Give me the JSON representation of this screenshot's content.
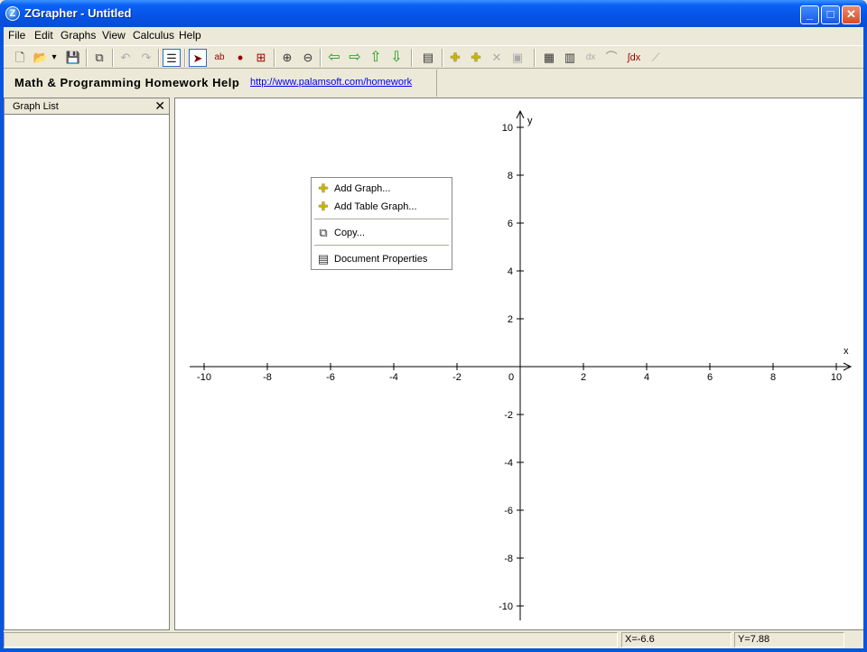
{
  "window": {
    "title": "ZGrapher - Untitled",
    "app_icon_letter": "Z",
    "minimize": "_",
    "maximize": "□",
    "close": "✕"
  },
  "menu": {
    "items": [
      "File",
      "Edit",
      "Graphs",
      "View",
      "Calculus",
      "Help"
    ]
  },
  "toolbar": {
    "buttons": [
      {
        "name": "new-icon",
        "glyph": "🗋"
      },
      {
        "name": "open-icon",
        "glyph": "📂"
      },
      {
        "name": "open-dropdown-icon",
        "glyph": "▾"
      },
      {
        "name": "save-icon",
        "glyph": "💾"
      },
      {
        "name": "copy-icon",
        "glyph": "⧉"
      },
      {
        "name": "undo-icon",
        "glyph": "↶"
      },
      {
        "name": "redo-icon",
        "glyph": "↷"
      },
      {
        "name": "graph-list-icon",
        "glyph": "☰"
      },
      {
        "name": "pointer-icon",
        "glyph": "➤"
      },
      {
        "name": "add-label-icon",
        "glyph": "ab"
      },
      {
        "name": "add-point-icon",
        "glyph": "•"
      },
      {
        "name": "zoom-box-icon",
        "glyph": "⊞"
      },
      {
        "name": "zoom-in-icon",
        "glyph": "⊕"
      },
      {
        "name": "zoom-out-icon",
        "glyph": "⊖"
      },
      {
        "name": "pan-left-icon",
        "glyph": "⇦"
      },
      {
        "name": "pan-right-icon",
        "glyph": "⇨"
      },
      {
        "name": "pan-up-icon",
        "glyph": "⇧"
      },
      {
        "name": "pan-down-icon",
        "glyph": "⇩"
      },
      {
        "name": "document-properties-icon",
        "glyph": "▤"
      },
      {
        "name": "add-graph-icon",
        "glyph": "✚"
      },
      {
        "name": "add-table-graph-icon",
        "glyph": "✚"
      },
      {
        "name": "delete-graph-icon",
        "glyph": "✕"
      },
      {
        "name": "graph-properties-icon",
        "glyph": "▣"
      },
      {
        "name": "table-icon",
        "glyph": "▦"
      },
      {
        "name": "calculator-icon",
        "glyph": "▥"
      },
      {
        "name": "derivative-icon",
        "glyph": "dx"
      },
      {
        "name": "tangent-icon",
        "glyph": "⌒"
      },
      {
        "name": "integral-icon",
        "glyph": "∫dx"
      },
      {
        "name": "regression-icon",
        "glyph": "⟋"
      }
    ]
  },
  "banner": {
    "title": "Math & Programming Homework Help",
    "link": "http://www.palamsoft.com/homework"
  },
  "graph_list": {
    "title": "Graph List",
    "close": "✕"
  },
  "context_menu": {
    "items": [
      {
        "label": "Add Graph...",
        "icon": "✚"
      },
      {
        "label": "Add Table Graph...",
        "icon": "✚"
      },
      {
        "label": "Copy...",
        "icon": "⧉"
      },
      {
        "label": "Document Properties",
        "icon": "▤"
      }
    ]
  },
  "chart_data": {
    "type": "line",
    "xlabel": "x",
    "ylabel": "y",
    "xlim": [
      -10,
      10
    ],
    "ylim": [
      -10,
      10
    ],
    "x_ticks": [
      -10,
      -8,
      -6,
      -4,
      -2,
      0,
      2,
      4,
      6,
      8,
      10
    ],
    "y_ticks": [
      10,
      8,
      6,
      4,
      2,
      -2,
      -4,
      -6,
      -8,
      -10
    ],
    "grid": false,
    "series": []
  },
  "status": {
    "x": "X=-6.6",
    "y": "Y=7.88"
  }
}
